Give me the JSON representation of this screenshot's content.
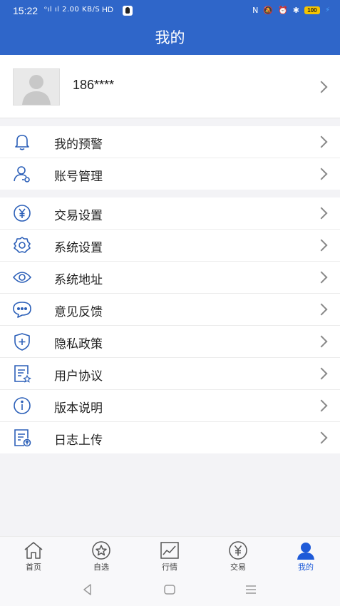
{
  "status_bar": {
    "time": "15:22",
    "network_info": "ᵒıl ıl 2.00 KB/S",
    "hd": "HD",
    "battery": "100"
  },
  "header": {
    "title": "我的"
  },
  "profile": {
    "phone": "186****"
  },
  "menu_group_1": [
    {
      "label": "我的预警",
      "icon": "bell-icon"
    },
    {
      "label": "账号管理",
      "icon": "account-icon"
    }
  ],
  "menu_group_2": [
    {
      "label": "交易设置",
      "icon": "yuan-circle-icon"
    },
    {
      "label": "系统设置",
      "icon": "gear-icon"
    },
    {
      "label": "系统地址",
      "icon": "eye-icon"
    },
    {
      "label": "意见反馈",
      "icon": "chat-bubble-icon"
    },
    {
      "label": "隐私政策",
      "icon": "shield-plus-icon"
    },
    {
      "label": "用户协议",
      "icon": "document-star-icon"
    },
    {
      "label": "版本说明",
      "icon": "info-icon"
    },
    {
      "label": "日志上传",
      "icon": "document-upload-icon"
    }
  ],
  "tab_bar": {
    "tabs": [
      {
        "label": "首页",
        "icon": "home-icon"
      },
      {
        "label": "自选",
        "icon": "star-icon"
      },
      {
        "label": "行情",
        "icon": "chart-icon"
      },
      {
        "label": "交易",
        "icon": "yuan-icon"
      },
      {
        "label": "我的",
        "icon": "person-icon"
      }
    ],
    "active_color": "#1e5ad8"
  },
  "colors": {
    "primary": "#2f66c9",
    "icon": "#2b5fb8"
  }
}
